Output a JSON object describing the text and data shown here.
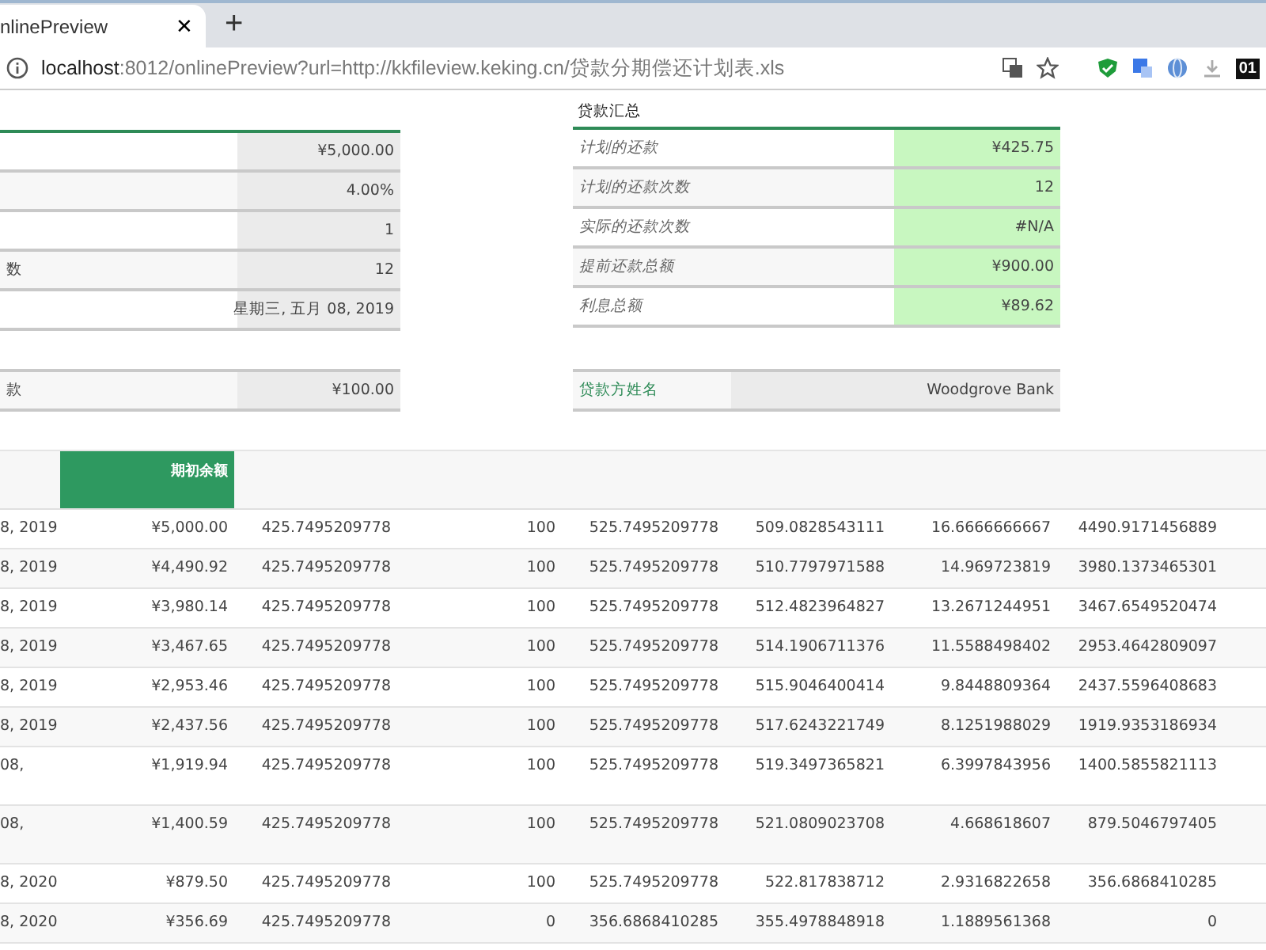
{
  "browser": {
    "tab_title": "nlinePreview",
    "url_host": "localhost",
    "url_rest": ":8012/onlinePreview?url=http://kkfileview.keking.cn/贷款分期偿还计划表.xls",
    "badge": "01",
    "tab_close": "✕",
    "new_tab": "+"
  },
  "loan_values": {
    "rows": [
      {
        "value": "¥5,000.00"
      },
      {
        "value": "4.00%"
      },
      {
        "value": "1"
      },
      {
        "label": "数",
        "value": "12"
      },
      {
        "value": "星期三, 五月 08, 2019"
      }
    ]
  },
  "loan_summary": {
    "title": "贷款汇总",
    "rows": [
      {
        "label": "计划的还款",
        "value": "¥425.75"
      },
      {
        "label": "计划的还款次数",
        "value": "12"
      },
      {
        "label": "实际的还款次数",
        "value": "#N/A"
      },
      {
        "label": "提前还款总额",
        "value": "¥900.00"
      },
      {
        "label": "利息总额",
        "value": "¥89.62"
      }
    ]
  },
  "extra": {
    "label": "款",
    "value": "¥100.00"
  },
  "lender": {
    "label": "贷款方姓名",
    "value": "Woodgrove Bank"
  },
  "schedule": {
    "columns": [
      {
        "selected": false
      },
      {
        "label": "期初余额",
        "selected": true
      },
      {
        "selected": false
      },
      {
        "selected": false
      },
      {
        "selected": false
      },
      {
        "selected": false
      },
      {
        "selected": false
      },
      {
        "selected": false
      }
    ],
    "rows": [
      {
        "cells": [
          "8, 2019",
          "¥5,000.00",
          "425.7495209778",
          "100",
          "525.7495209778",
          "509.0828543111",
          "16.6666666667",
          "4490.9171456889"
        ]
      },
      {
        "cells": [
          "8, 2019",
          "¥4,490.92",
          "425.7495209778",
          "100",
          "525.7495209778",
          "510.7797971588",
          "14.969723819",
          "3980.1373465301"
        ]
      },
      {
        "cells": [
          "8, 2019",
          "¥3,980.14",
          "425.7495209778",
          "100",
          "525.7495209778",
          "512.4823964827",
          "13.2671244951",
          "3467.6549520474"
        ]
      },
      {
        "cells": [
          "8, 2019",
          "¥3,467.65",
          "425.7495209778",
          "100",
          "525.7495209778",
          "514.1906711376",
          "11.5588498402",
          "2953.4642809097"
        ]
      },
      {
        "cells": [
          "8, 2019",
          "¥2,953.46",
          "425.7495209778",
          "100",
          "525.7495209778",
          "515.9046400414",
          "9.8448809364",
          "2437.5596408683"
        ]
      },
      {
        "cells": [
          "8, 2019",
          "¥2,437.56",
          "425.7495209778",
          "100",
          "525.7495209778",
          "517.6243221749",
          "8.1251988029",
          "1919.9353186934"
        ]
      },
      {
        "tall": true,
        "cells": [
          "08,",
          "¥1,919.94",
          "425.7495209778",
          "100",
          "525.7495209778",
          "519.3497365821",
          "6.3997843956",
          "1400.5855821113"
        ]
      },
      {
        "tall": true,
        "cells": [
          "08,",
          "¥1,400.59",
          "425.7495209778",
          "100",
          "525.7495209778",
          "521.0809023708",
          "4.668618607",
          "879.5046797405"
        ]
      },
      {
        "cells": [
          "8, 2020",
          "¥879.50",
          "425.7495209778",
          "100",
          "525.7495209778",
          "522.817838712",
          "2.9316822658",
          "356.6868410285"
        ]
      },
      {
        "cells": [
          "8, 2020",
          "¥356.69",
          "425.7495209778",
          "0",
          "356.6868410285",
          "355.4978848918",
          "1.1889561368",
          "0"
        ]
      }
    ]
  }
}
